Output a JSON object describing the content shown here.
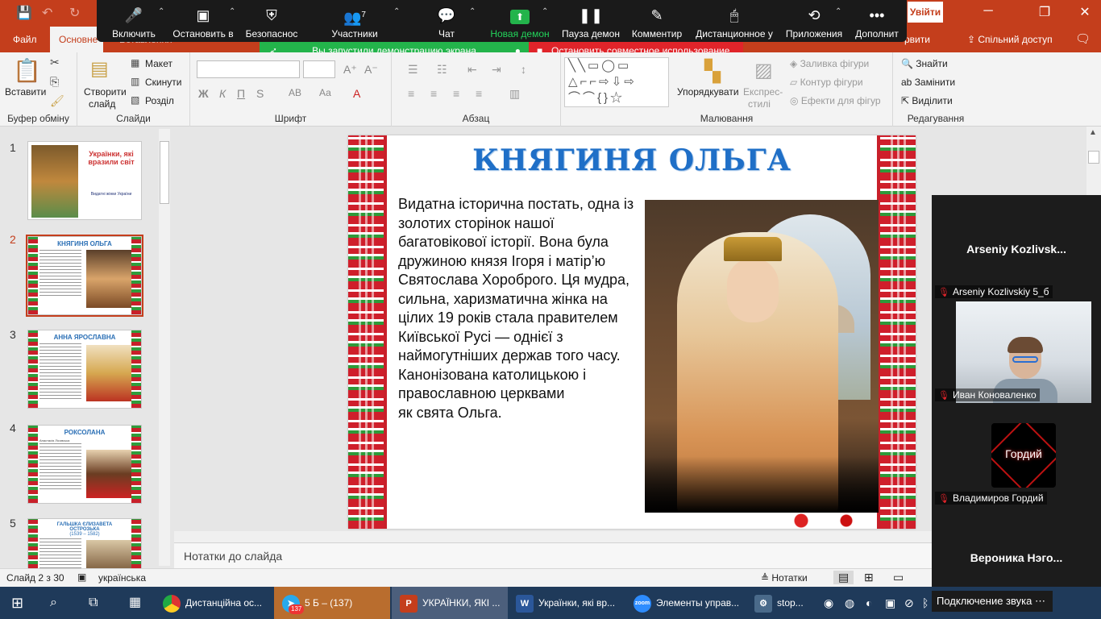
{
  "app": {
    "file_tab": "Файл",
    "home_tab": "Основне",
    "header_fragment_left": "Вставлення",
    "header_fragment_right": "рвити",
    "login": "Увійти",
    "share": "Спільний доступ"
  },
  "zoom": {
    "items": [
      {
        "label": "Включить",
        "icon": "microphone-icon"
      },
      {
        "label": "Остановить в",
        "icon": "video-icon"
      },
      {
        "label": "Безопаснос",
        "icon": "shield-icon"
      },
      {
        "label": "Участники",
        "icon": "participants-icon",
        "count": "7"
      },
      {
        "label": "Чат",
        "icon": "chat-icon"
      },
      {
        "label": "Новая демон",
        "icon": "share-screen-icon"
      },
      {
        "label": "Пауза демон",
        "icon": "pause-icon"
      },
      {
        "label": "Комментир",
        "icon": "pen-icon"
      },
      {
        "label": "Дистанционное у",
        "icon": "mouse-icon"
      },
      {
        "label": "Приложения",
        "icon": "apps-icon"
      },
      {
        "label": "Дополнит",
        "icon": "more-icon"
      }
    ],
    "share_banner": "Вы запустили демонстрацию экрана",
    "stop_share": "Остановить совместное использование"
  },
  "ribbon": {
    "groups": {
      "clipboard": "Буфер обміну",
      "slides": "Слайди",
      "font": "Шрифт",
      "paragraph": "Абзац",
      "drawing": "Малювання",
      "editing": "Редагування"
    },
    "paste": "Вставити",
    "new_slide_1": "Створити",
    "new_slide_2": "слайд",
    "layout": "Макет",
    "reset": "Скинути",
    "section": "Розділ",
    "arrange": "Упорядкувати",
    "quick_styles_1": "Експрес-",
    "quick_styles_2": "стилі",
    "shape_fill": "Заливка фігури",
    "shape_outline": "Контур фігури",
    "shape_effects": "Ефекти для фігур",
    "find": "Знайти",
    "replace": "Замінити",
    "select": "Виділити",
    "bold": "Ж",
    "italic": "К",
    "underline": "П",
    "strike": "S",
    "spacing": "АВ",
    "case": "Аа"
  },
  "thumbnails": [
    {
      "num": "1",
      "title": "Українки, які вразили світ",
      "sub": "Видатні жінки України"
    },
    {
      "num": "2",
      "title": "КНЯГИНЯ ОЛЬГА"
    },
    {
      "num": "3",
      "title": "АННА ЯРОСЛАВНА"
    },
    {
      "num": "4",
      "title": "РОКСОЛАНА",
      "sub": "Анастасія Лісовська"
    },
    {
      "num": "5",
      "title": "ГАЛЬШКА ЄЛИЗАВЕТА ОСТРОЗЬКА",
      "sub": "(1539 – 1582)"
    }
  ],
  "slide": {
    "title": "КНЯГИНЯ ОЛЬГА",
    "body": " Видатна історична постать, одна із золотих сторінок нашої багатовікової історії. Вона була дружиною князя Ігоря  і матір’ю Святослава Хороброго. Ця мудра, сильна, харизматична жінка на цілих 19 років стала правителем Київської Русі — однієї з наймогутніших держав того часу.\nКанонізована католицькою і православною церквами\nяк свята Ольга."
  },
  "notes_placeholder": "Нотатки до слайда",
  "status": {
    "slide_counter": "Слайд 2 з 30",
    "language": "українська",
    "notes_button": "Нотатки"
  },
  "video": {
    "top_name": "Arseniy  Kozlivsk...",
    "p1": "Arseniy Kozlivskiy 5_б",
    "p2": "Иван Коноваленко",
    "p3_avatar": "Гордий",
    "p3": "Владимиров Гордий",
    "p4": "Вероника  Нэго..."
  },
  "taskbar": {
    "chrome": "Дистанційна ос...",
    "telegram": "5 Б – (137)",
    "telegram_badge": "137",
    "ppt": "УКРАЇНКИ, ЯКІ ...",
    "word": "Українки, які вр...",
    "zoom": "Элементы управ...",
    "stop": "stop...",
    "notif": "Подключение звука"
  },
  "colors": {
    "accent": "#c43e1c",
    "share_green": "#23b44b",
    "stop_red": "#e0242a",
    "title_blue": "#1f6fc7"
  }
}
